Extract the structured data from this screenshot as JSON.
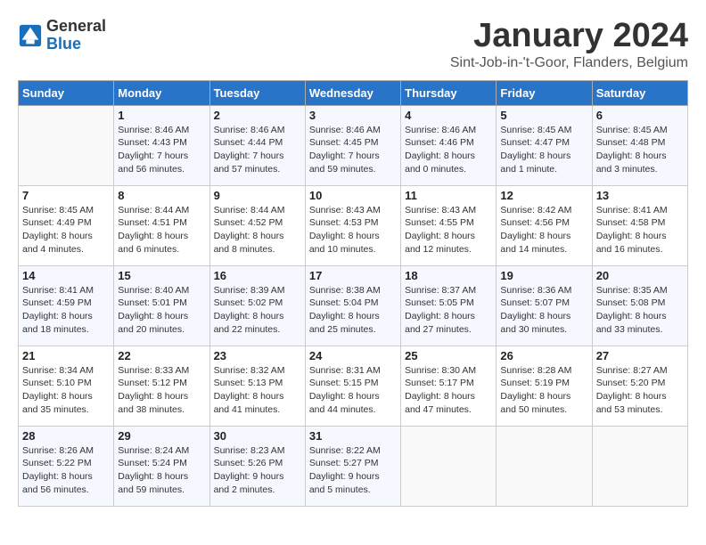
{
  "header": {
    "logo_line1": "General",
    "logo_line2": "Blue",
    "title": "January 2024",
    "subtitle": "Sint-Job-in-'t-Goor, Flanders, Belgium"
  },
  "days_of_week": [
    "Sunday",
    "Monday",
    "Tuesday",
    "Wednesday",
    "Thursday",
    "Friday",
    "Saturday"
  ],
  "weeks": [
    [
      {
        "day": "",
        "info": ""
      },
      {
        "day": "1",
        "info": "Sunrise: 8:46 AM\nSunset: 4:43 PM\nDaylight: 7 hours\nand 56 minutes."
      },
      {
        "day": "2",
        "info": "Sunrise: 8:46 AM\nSunset: 4:44 PM\nDaylight: 7 hours\nand 57 minutes."
      },
      {
        "day": "3",
        "info": "Sunrise: 8:46 AM\nSunset: 4:45 PM\nDaylight: 7 hours\nand 59 minutes."
      },
      {
        "day": "4",
        "info": "Sunrise: 8:46 AM\nSunset: 4:46 PM\nDaylight: 8 hours\nand 0 minutes."
      },
      {
        "day": "5",
        "info": "Sunrise: 8:45 AM\nSunset: 4:47 PM\nDaylight: 8 hours\nand 1 minute."
      },
      {
        "day": "6",
        "info": "Sunrise: 8:45 AM\nSunset: 4:48 PM\nDaylight: 8 hours\nand 3 minutes."
      }
    ],
    [
      {
        "day": "7",
        "info": "Sunrise: 8:45 AM\nSunset: 4:49 PM\nDaylight: 8 hours\nand 4 minutes."
      },
      {
        "day": "8",
        "info": "Sunrise: 8:44 AM\nSunset: 4:51 PM\nDaylight: 8 hours\nand 6 minutes."
      },
      {
        "day": "9",
        "info": "Sunrise: 8:44 AM\nSunset: 4:52 PM\nDaylight: 8 hours\nand 8 minutes."
      },
      {
        "day": "10",
        "info": "Sunrise: 8:43 AM\nSunset: 4:53 PM\nDaylight: 8 hours\nand 10 minutes."
      },
      {
        "day": "11",
        "info": "Sunrise: 8:43 AM\nSunset: 4:55 PM\nDaylight: 8 hours\nand 12 minutes."
      },
      {
        "day": "12",
        "info": "Sunrise: 8:42 AM\nSunset: 4:56 PM\nDaylight: 8 hours\nand 14 minutes."
      },
      {
        "day": "13",
        "info": "Sunrise: 8:41 AM\nSunset: 4:58 PM\nDaylight: 8 hours\nand 16 minutes."
      }
    ],
    [
      {
        "day": "14",
        "info": "Sunrise: 8:41 AM\nSunset: 4:59 PM\nDaylight: 8 hours\nand 18 minutes."
      },
      {
        "day": "15",
        "info": "Sunrise: 8:40 AM\nSunset: 5:01 PM\nDaylight: 8 hours\nand 20 minutes."
      },
      {
        "day": "16",
        "info": "Sunrise: 8:39 AM\nSunset: 5:02 PM\nDaylight: 8 hours\nand 22 minutes."
      },
      {
        "day": "17",
        "info": "Sunrise: 8:38 AM\nSunset: 5:04 PM\nDaylight: 8 hours\nand 25 minutes."
      },
      {
        "day": "18",
        "info": "Sunrise: 8:37 AM\nSunset: 5:05 PM\nDaylight: 8 hours\nand 27 minutes."
      },
      {
        "day": "19",
        "info": "Sunrise: 8:36 AM\nSunset: 5:07 PM\nDaylight: 8 hours\nand 30 minutes."
      },
      {
        "day": "20",
        "info": "Sunrise: 8:35 AM\nSunset: 5:08 PM\nDaylight: 8 hours\nand 33 minutes."
      }
    ],
    [
      {
        "day": "21",
        "info": "Sunrise: 8:34 AM\nSunset: 5:10 PM\nDaylight: 8 hours\nand 35 minutes."
      },
      {
        "day": "22",
        "info": "Sunrise: 8:33 AM\nSunset: 5:12 PM\nDaylight: 8 hours\nand 38 minutes."
      },
      {
        "day": "23",
        "info": "Sunrise: 8:32 AM\nSunset: 5:13 PM\nDaylight: 8 hours\nand 41 minutes."
      },
      {
        "day": "24",
        "info": "Sunrise: 8:31 AM\nSunset: 5:15 PM\nDaylight: 8 hours\nand 44 minutes."
      },
      {
        "day": "25",
        "info": "Sunrise: 8:30 AM\nSunset: 5:17 PM\nDaylight: 8 hours\nand 47 minutes."
      },
      {
        "day": "26",
        "info": "Sunrise: 8:28 AM\nSunset: 5:19 PM\nDaylight: 8 hours\nand 50 minutes."
      },
      {
        "day": "27",
        "info": "Sunrise: 8:27 AM\nSunset: 5:20 PM\nDaylight: 8 hours\nand 53 minutes."
      }
    ],
    [
      {
        "day": "28",
        "info": "Sunrise: 8:26 AM\nSunset: 5:22 PM\nDaylight: 8 hours\nand 56 minutes."
      },
      {
        "day": "29",
        "info": "Sunrise: 8:24 AM\nSunset: 5:24 PM\nDaylight: 8 hours\nand 59 minutes."
      },
      {
        "day": "30",
        "info": "Sunrise: 8:23 AM\nSunset: 5:26 PM\nDaylight: 9 hours\nand 2 minutes."
      },
      {
        "day": "31",
        "info": "Sunrise: 8:22 AM\nSunset: 5:27 PM\nDaylight: 9 hours\nand 5 minutes."
      },
      {
        "day": "",
        "info": ""
      },
      {
        "day": "",
        "info": ""
      },
      {
        "day": "",
        "info": ""
      }
    ]
  ]
}
